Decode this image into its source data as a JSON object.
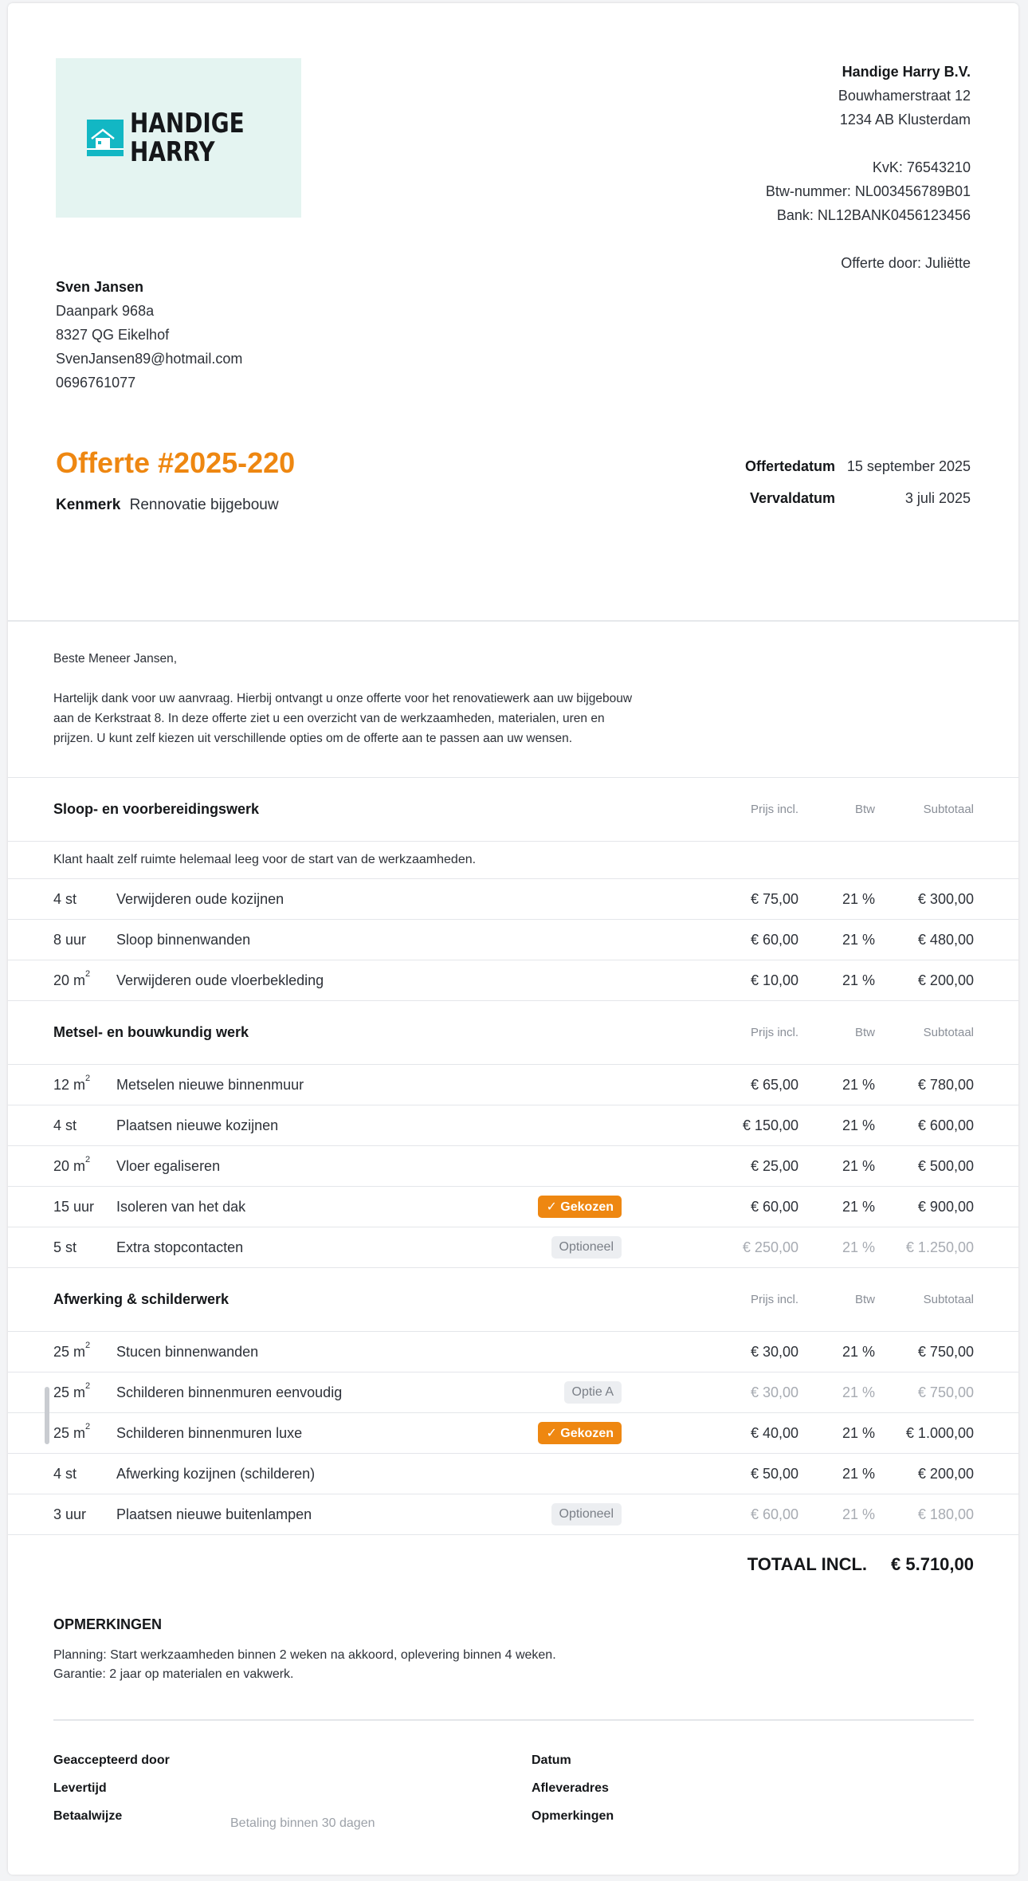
{
  "company": {
    "name": "Handige Harry B.V.",
    "street": "Bouwhamerstraat 12",
    "city": "1234 AB Klusterdam",
    "kvk": "KvK: 76543210",
    "btw": "Btw-nummer: NL003456789B01",
    "bank": "Bank: NL12BANK0456123456",
    "offer_by": "Offerte door: Juliëtte"
  },
  "logo": {
    "line1": "HANDIGE",
    "line2": "HARRY",
    "icon": "house-icon"
  },
  "customer": {
    "name": "Sven Jansen",
    "street": "Daanpark 968a",
    "city": "8327 QG Eikelhof",
    "email": "SvenJansen89@hotmail.com",
    "phone": "0696761077"
  },
  "offer": {
    "title": "Offerte #2025-220",
    "kenmerk_label": "Kenmerk",
    "kenmerk_value": "Rennovatie bijgebouw",
    "date_label": "Offertedatum",
    "date_value": "15 september 2025",
    "expiry_label": "Vervaldatum",
    "expiry_value": "3 juli 2025"
  },
  "letter": {
    "greeting": "Beste Meneer Jansen,",
    "body": "Hartelijk dank voor uw aanvraag. Hierbij ontvangt u onze offerte voor het renovatiewerk aan uw bijgebouw aan de Kerkstraat 8. In deze offerte ziet u een overzicht van de werkzaamheden, materialen, uren en prijzen. U kunt zelf kiezen uit verschillende opties om de offerte aan te passen aan uw wensen."
  },
  "table": {
    "headers": {
      "price": "Prijs incl.",
      "btw": "Btw",
      "subtotal": "Subtotaal"
    },
    "sections": [
      {
        "name": "Sloop- en voorbereidingswerk",
        "note": "Klant haalt zelf ruimte helemaal leeg voor de start van de werkzaamheden.",
        "rows": [
          {
            "qty": "4 st",
            "desc": "Verwijderen oude kozijnen",
            "price": "€ 75,00",
            "btw": "21 %",
            "subtotal": "€ 300,00"
          },
          {
            "qty": "8 uur",
            "desc": "Sloop binnenwanden",
            "price": "€ 60,00",
            "btw": "21 %",
            "subtotal": "€ 480,00"
          },
          {
            "qty": "20 m",
            "desc": "Verwijderen oude vloerbekleding",
            "price": "€ 10,00",
            "btw": "21 %",
            "subtotal": "€ 200,00"
          }
        ]
      },
      {
        "name": "Metsel- en bouwkundig werk",
        "rows": [
          {
            "qty": "12 m",
            "desc": "Metselen nieuwe binnenmuur",
            "price": "€ 65,00",
            "btw": "21 %",
            "subtotal": "€ 780,00"
          },
          {
            "qty": "4 st",
            "desc": "Plaatsen nieuwe kozijnen",
            "price": "€ 150,00",
            "btw": "21 %",
            "subtotal": "€ 600,00"
          },
          {
            "qty": "20 m",
            "desc": "Vloer egaliseren",
            "price": "€ 25,00",
            "btw": "21 %",
            "subtotal": "€ 500,00"
          },
          {
            "qty": "15 uur",
            "desc": "Isoleren van het dak",
            "badge": "✓ Gekozen",
            "price": "€ 60,00",
            "btw": "21 %",
            "subtotal": "€ 900,00"
          },
          {
            "qty": "5 st",
            "desc": "Extra stopcontacten",
            "badge": "Optioneel",
            "price": "€ 250,00",
            "btw": "21 %",
            "subtotal": "€ 1.250,00"
          }
        ]
      },
      {
        "name": "Afwerking & schilderwerk",
        "rows": [
          {
            "qty": "25 m",
            "desc": "Stucen binnenwanden",
            "price": "€ 30,00",
            "btw": "21 %",
            "subtotal": "€ 750,00"
          },
          {
            "qty": "25 m",
            "desc": "Schilderen binnenmuren eenvoudig",
            "badge": "Optie A",
            "price": "€ 30,00",
            "btw": "21 %",
            "subtotal": "€ 750,00"
          },
          {
            "qty": "25 m",
            "desc": "Schilderen binnenmuren luxe",
            "badge": "✓ Gekozen",
            "price": "€ 40,00",
            "btw": "21 %",
            "subtotal": "€ 1.000,00"
          },
          {
            "qty": "4 st",
            "desc": "Afwerking kozijnen (schilderen)",
            "price": "€ 50,00",
            "btw": "21 %",
            "subtotal": "€ 200,00"
          },
          {
            "qty": "3 uur",
            "desc": "Plaatsen nieuwe buitenlampen",
            "badge": "Optioneel",
            "price": "€ 60,00",
            "btw": "21 %",
            "subtotal": "€ 180,00"
          }
        ]
      }
    ],
    "sup": "2"
  },
  "total": {
    "label": "TOTAAL INCL.",
    "value": "€ 5.710,00"
  },
  "remarks": {
    "title": "OPMERKINGEN",
    "line1": "Planning: Start werkzaamheden binnen 2 weken na akkoord, oplevering binnen 4 weken.",
    "line2": "Garantie: 2 jaar op materialen en vakwerk."
  },
  "signature": {
    "accepted_by": "Geaccepteerd door",
    "delivery_time": "Levertijd",
    "payment": "Betaalwijze",
    "payment_value": "Betaling binnen 30 dagen",
    "date": "Datum",
    "delivery_address": "Afleveradres",
    "notes": "Opmerkingen"
  }
}
